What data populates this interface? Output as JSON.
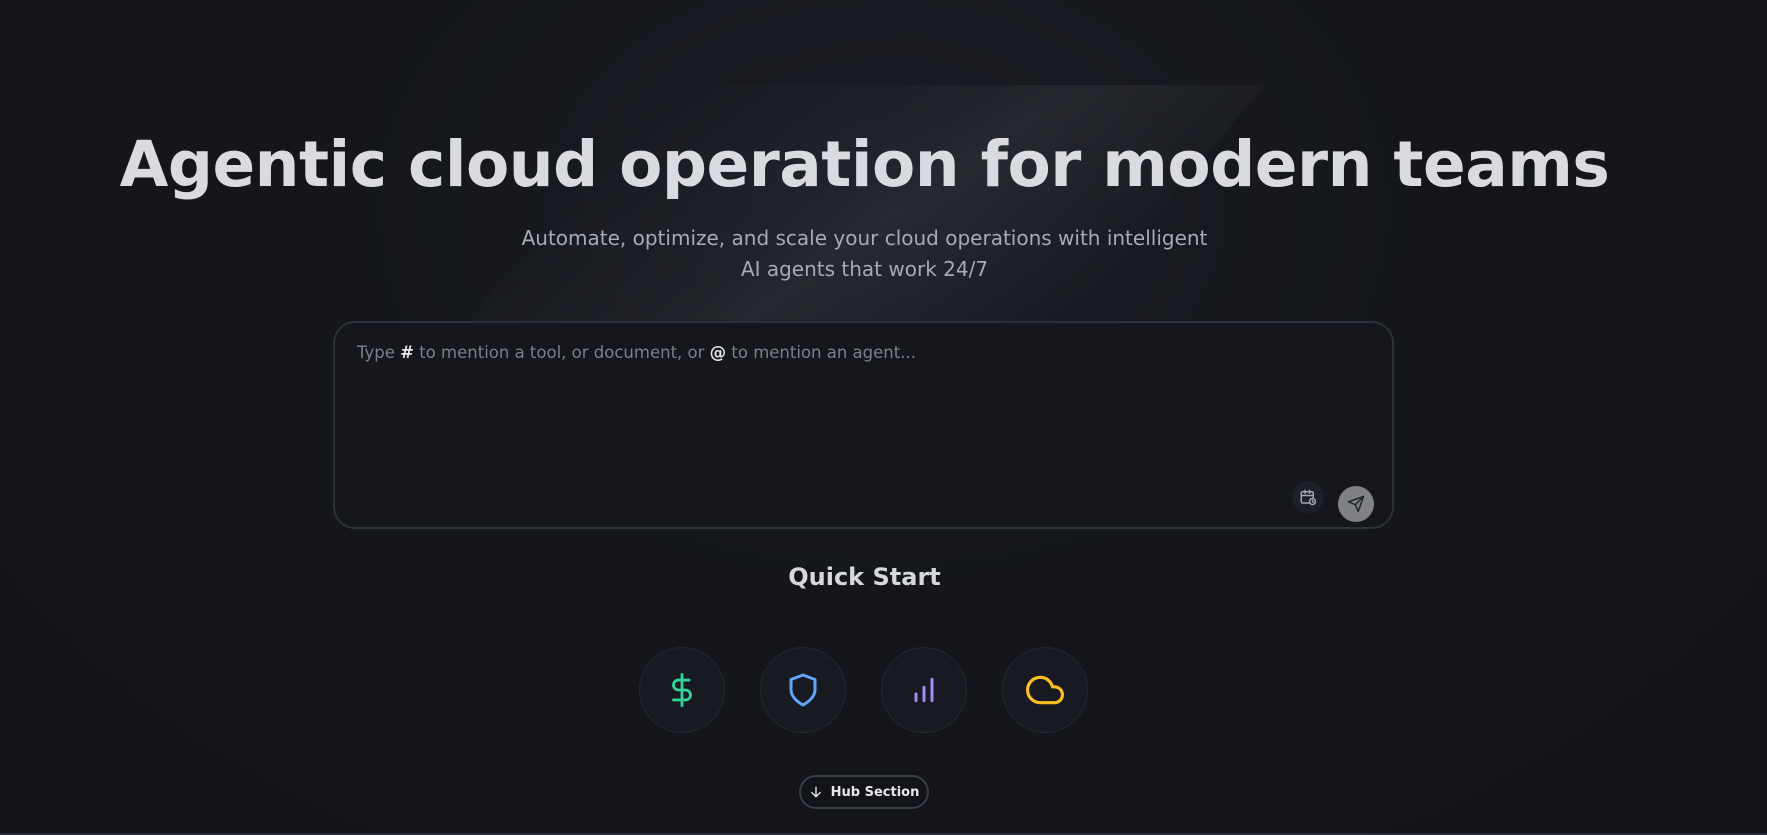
{
  "hero": {
    "title": "Agentic cloud operation for modern teams",
    "subtitle_line1": "Automate, optimize, and scale your cloud operations with intelligent",
    "subtitle_line2": "AI agents that work 24/7"
  },
  "prompt": {
    "placeholder_part1": "Type ",
    "placeholder_hash": "#",
    "placeholder_part2": " to mention a tool, or document, or ",
    "placeholder_at": "@",
    "placeholder_part3": " to mention an agent...",
    "schedule_icon": "calendar-clock-icon",
    "send_icon": "send-icon"
  },
  "quick_start": {
    "title": "Quick Start",
    "items": [
      {
        "icon": "dollar-icon",
        "color": "#34d399"
      },
      {
        "icon": "shield-icon",
        "color": "#60a5fa"
      },
      {
        "icon": "bar-chart-icon",
        "color": "#a78bfa"
      },
      {
        "icon": "cloud-icon",
        "color": "#fbbf24"
      }
    ]
  },
  "hub": {
    "label": "Hub Section",
    "icon": "arrow-down-icon"
  }
}
